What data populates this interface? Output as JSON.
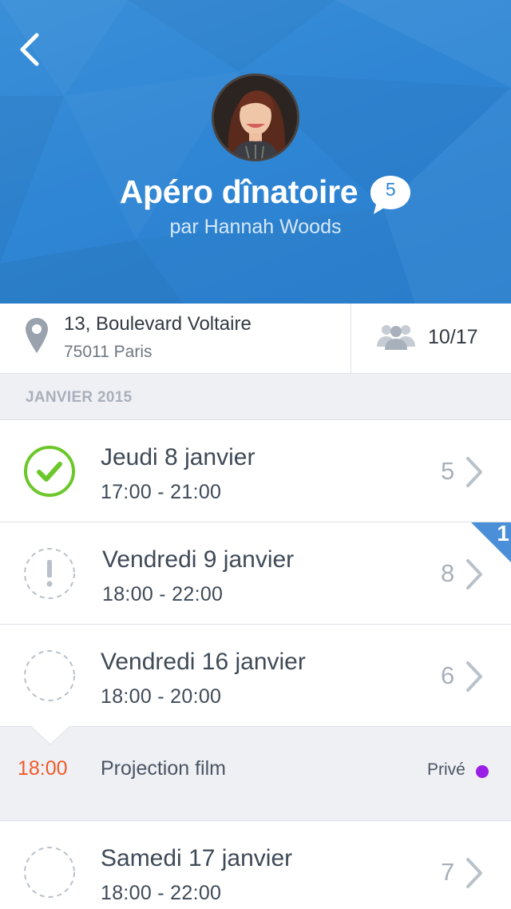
{
  "header": {
    "title": "Apéro dînatoire",
    "subtitle": "par Hannah Woods",
    "comment_count": "5",
    "back_icon": "chevron-left-icon",
    "background_color": "#2f86d4"
  },
  "info": {
    "address_line1": "13, Boulevard Voltaire",
    "address_line2": "75011 Paris",
    "attendees": "10/17",
    "location_icon": "map-pin-icon",
    "attendees_icon": "people-icon"
  },
  "section": {
    "title": "JANVIER 2015"
  },
  "dates": [
    {
      "title": "Jeudi 8 janvier",
      "time": "17:00 - 21:00",
      "count": "5",
      "status": "confirmed"
    },
    {
      "title": "Vendredi 9 janvier",
      "time": "18:00 - 22:00",
      "count": "8",
      "status": "attention",
      "badge": "1"
    },
    {
      "title": "Vendredi 16 janvier",
      "time": "18:00 - 20:00",
      "count": "6",
      "status": "pending"
    },
    {
      "title": "Samedi 17 janvier",
      "time": "18:00 - 22:00",
      "count": "7",
      "status": "pending"
    }
  ],
  "sub_event": {
    "time": "18:00",
    "name": "Projection film",
    "privacy": "Privé",
    "time_color": "#f05a28",
    "dot_color": "#9b1ee6"
  },
  "colors": {
    "accent_blue": "#2f86d4",
    "confirm_green": "#6cc72a",
    "muted_gray": "#a7b0bb"
  }
}
